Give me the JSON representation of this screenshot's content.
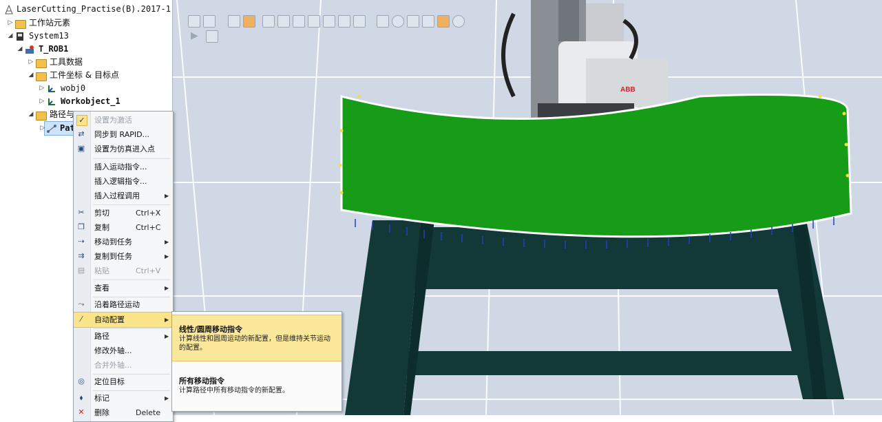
{
  "tree": {
    "file_title": "LaserCutting_Practise(B).2017-1-6*",
    "items": [
      {
        "label": "工作站元素"
      },
      {
        "label": "System13"
      },
      {
        "label": "T_ROB1"
      },
      {
        "label": "工具数据"
      },
      {
        "label": "工件坐标 & 目标点"
      },
      {
        "label": "wobj0"
      },
      {
        "label": "Workobject_1"
      },
      {
        "label": "路径与"
      },
      {
        "label": "Pat"
      }
    ]
  },
  "context_menu": {
    "items": [
      {
        "label": "设置为激活",
        "shortcut": ""
      },
      {
        "label": "同步到 RAPID...",
        "shortcut": ""
      },
      {
        "label": "设置为仿真进入点",
        "shortcut": ""
      },
      {
        "label": "插入运动指令...",
        "shortcut": ""
      },
      {
        "label": "插入逻辑指令...",
        "shortcut": ""
      },
      {
        "label": "插入过程调用",
        "shortcut": ""
      },
      {
        "label": "剪切",
        "shortcut": "Ctrl+X"
      },
      {
        "label": "复制",
        "shortcut": "Ctrl+C"
      },
      {
        "label": "移动到任务",
        "shortcut": ""
      },
      {
        "label": "复制到任务",
        "shortcut": ""
      },
      {
        "label": "粘贴",
        "shortcut": "Ctrl+V"
      },
      {
        "label": "查看",
        "shortcut": ""
      },
      {
        "label": "沿着路径运动",
        "shortcut": ""
      },
      {
        "label": "自动配置",
        "shortcut": ""
      },
      {
        "label": "路径",
        "shortcut": ""
      },
      {
        "label": "修改外轴...",
        "shortcut": ""
      },
      {
        "label": "合并外轴...",
        "shortcut": ""
      },
      {
        "label": "定位目标",
        "shortcut": ""
      },
      {
        "label": "标记",
        "shortcut": ""
      },
      {
        "label": "删除",
        "shortcut": "Delete"
      }
    ]
  },
  "submenu": {
    "items": [
      {
        "title": "线性/圆周移动指令",
        "desc": "计算线性和圆周运动的新配置，但是维持关节运动的配置。"
      },
      {
        "title": "所有移动指令",
        "desc": "计算路径中所有移动指令的新配置。"
      }
    ]
  },
  "viewport": {
    "brand_label": "ABB",
    "part_color": "#169c16",
    "stand_color": "#123838"
  }
}
